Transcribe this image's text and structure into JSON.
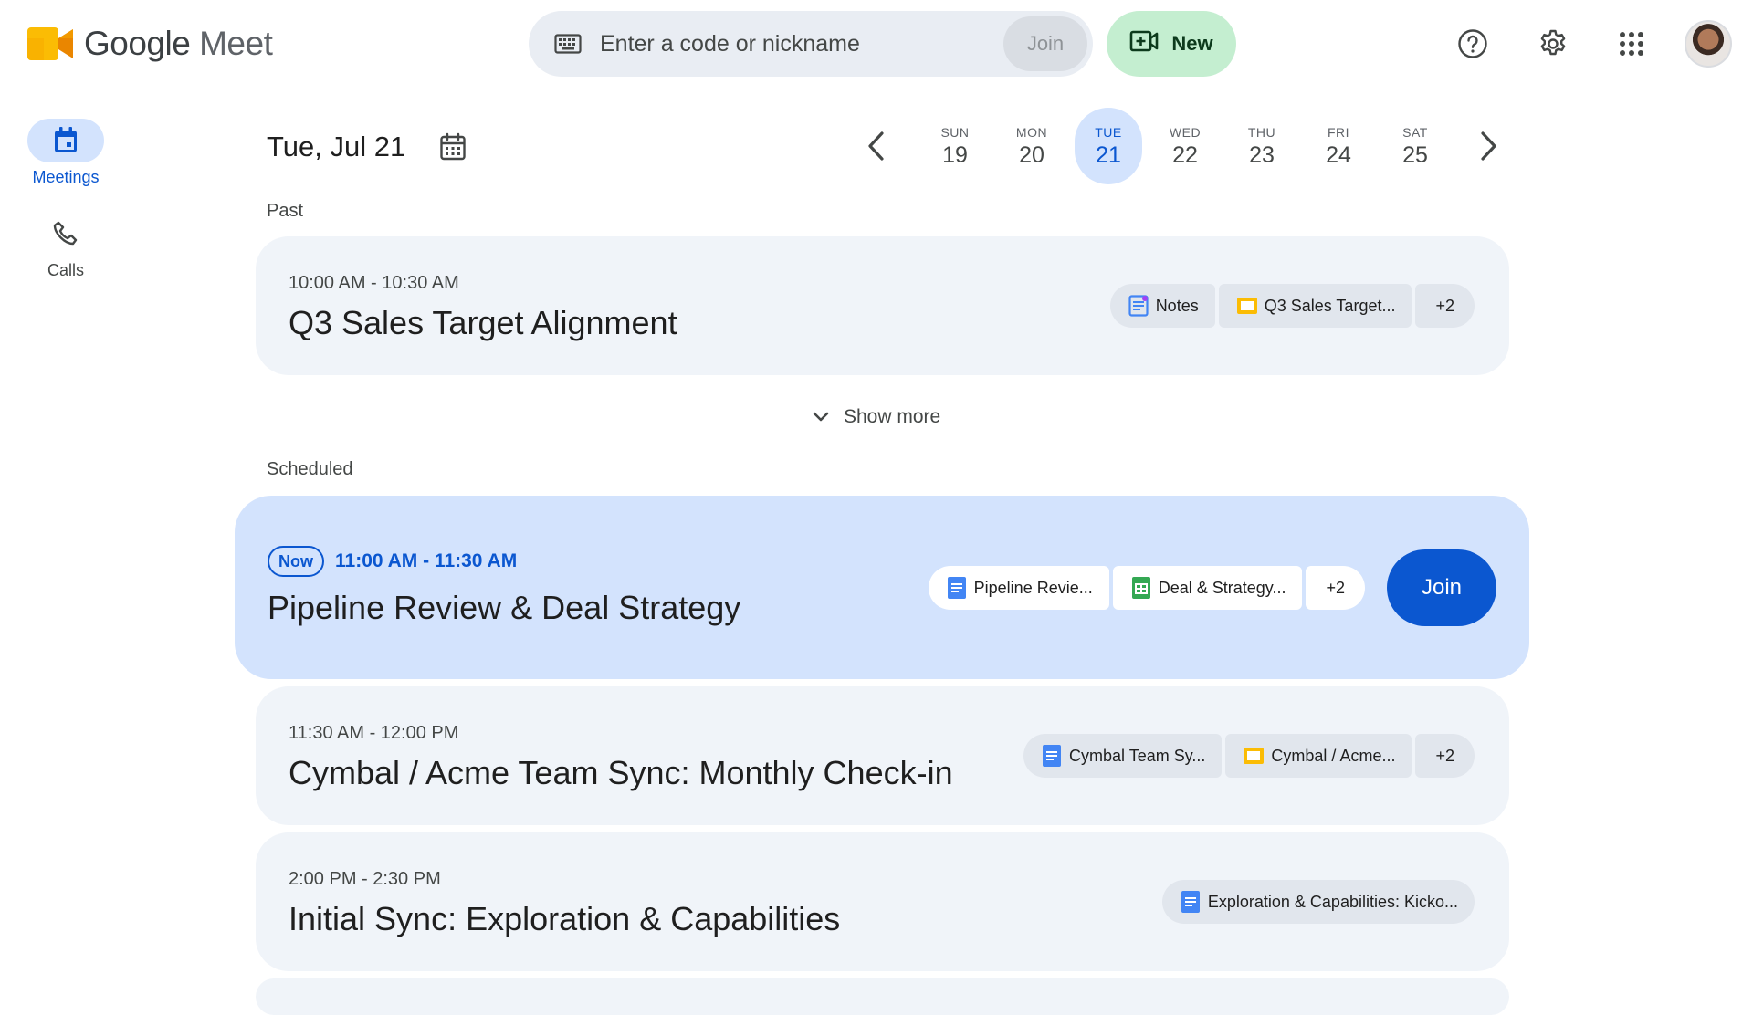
{
  "header": {
    "app_name_google": "Google",
    "app_name_meet": "Meet",
    "search_placeholder": "Enter a code or nickname",
    "search_join_label": "Join",
    "new_label": "New",
    "icons": [
      "help-icon",
      "settings-icon",
      "apps-grid-icon"
    ]
  },
  "sidebar": {
    "items": [
      {
        "label": "Meetings",
        "icon": "calendar-icon",
        "active": true
      },
      {
        "label": "Calls",
        "icon": "phone-icon",
        "active": false
      }
    ]
  },
  "date_nav": {
    "current_date": "Tue, Jul 21",
    "days": [
      {
        "dow": "SUN",
        "num": "19",
        "selected": false
      },
      {
        "dow": "MON",
        "num": "20",
        "selected": false
      },
      {
        "dow": "TUE",
        "num": "21",
        "selected": true
      },
      {
        "dow": "WED",
        "num": "22",
        "selected": false
      },
      {
        "dow": "THU",
        "num": "23",
        "selected": false
      },
      {
        "dow": "FRI",
        "num": "24",
        "selected": false
      },
      {
        "dow": "SAT",
        "num": "25",
        "selected": false
      }
    ]
  },
  "sections": {
    "past_label": "Past",
    "scheduled_label": "Scheduled",
    "show_more_label": "Show more"
  },
  "meetings": {
    "past": [
      {
        "time": "10:00 AM - 10:30 AM",
        "title": "Q3 Sales Target Alignment",
        "attachments": [
          {
            "label": "Notes",
            "icon": "notes-icon"
          },
          {
            "label": "Q3 Sales Target...",
            "icon": "slides-icon"
          }
        ],
        "more": "+2"
      }
    ],
    "now": {
      "badge": "Now",
      "time": "11:00 AM - 11:30 AM",
      "title": "Pipeline Review & Deal Strategy",
      "attachments": [
        {
          "label": "Pipeline Revie...",
          "icon": "docs-icon"
        },
        {
          "label": "Deal & Strategy...",
          "icon": "sheets-icon"
        }
      ],
      "more": "+2",
      "join_label": "Join"
    },
    "scheduled": [
      {
        "time": "11:30 AM - 12:00 PM",
        "title": "Cymbal / Acme Team Sync: Monthly Check-in",
        "attachments": [
          {
            "label": "Cymbal Team Sy...",
            "icon": "docs-icon"
          },
          {
            "label": "Cymbal / Acme...",
            "icon": "slides-icon"
          }
        ],
        "more": "+2"
      },
      {
        "time": "2:00 PM - 2:30 PM",
        "title": "Initial Sync: Exploration & Capabilities",
        "attachments": [
          {
            "label": "Exploration & Capabilities: Kicko...",
            "icon": "docs-icon"
          }
        ]
      }
    ]
  },
  "colors": {
    "accent_blue": "#0b57d0",
    "now_card_bg": "#d3e3fd",
    "card_bg": "#f0f4f9",
    "new_button_bg": "#c4eed0",
    "docs_blue": "#4285f4",
    "sheets_green": "#34a853",
    "slides_yellow": "#fbbc04"
  }
}
